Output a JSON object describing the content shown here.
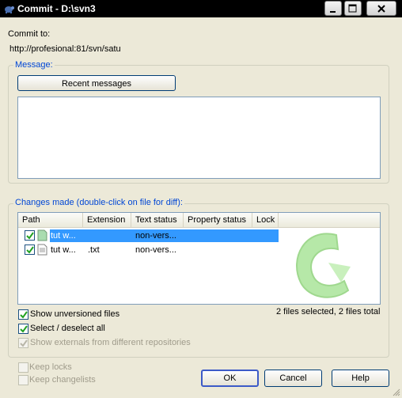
{
  "window": {
    "title": "Commit - D:\\svn3",
    "minimize_icon": "minimize-icon",
    "maximize_icon": "maximize-icon",
    "close_icon": "close-icon"
  },
  "commit_to": {
    "label": "Commit to:",
    "url": "http://profesional:81/svn/satu"
  },
  "message_group": {
    "legend": "Message:",
    "recent_button": "Recent messages",
    "message_value": ""
  },
  "changes_group": {
    "legend": "Changes made (double-click on file for diff):",
    "columns": [
      "Path",
      "Extension",
      "Text status",
      "Property status",
      "Lock"
    ],
    "rows": [
      {
        "checked": true,
        "selected": true,
        "path": "tut w...",
        "extension": "",
        "text_status": "non-vers...",
        "property_status": "",
        "lock": ""
      },
      {
        "checked": true,
        "selected": false,
        "path": "tut w...",
        "extension": ".txt",
        "text_status": "non-vers...",
        "property_status": "",
        "lock": ""
      }
    ],
    "show_unversioned": {
      "label": "Show unversioned files",
      "checked": true
    },
    "select_all": {
      "label": "Select / deselect all",
      "checked": true
    },
    "show_externals": {
      "label": "Show externals from different repositories",
      "checked": true,
      "disabled": true
    },
    "summary": "2 files selected, 2 files total"
  },
  "options": {
    "keep_locks": {
      "label": "Keep locks",
      "checked": false,
      "disabled": true
    },
    "keep_changelists": {
      "label": "Keep changelists",
      "checked": false,
      "disabled": true
    }
  },
  "buttons": {
    "ok": "OK",
    "cancel": "Cancel",
    "help": "Help"
  },
  "colors": {
    "accent": "#0046d5",
    "selection": "#3399ff",
    "watermark": "#b6e8a8"
  }
}
